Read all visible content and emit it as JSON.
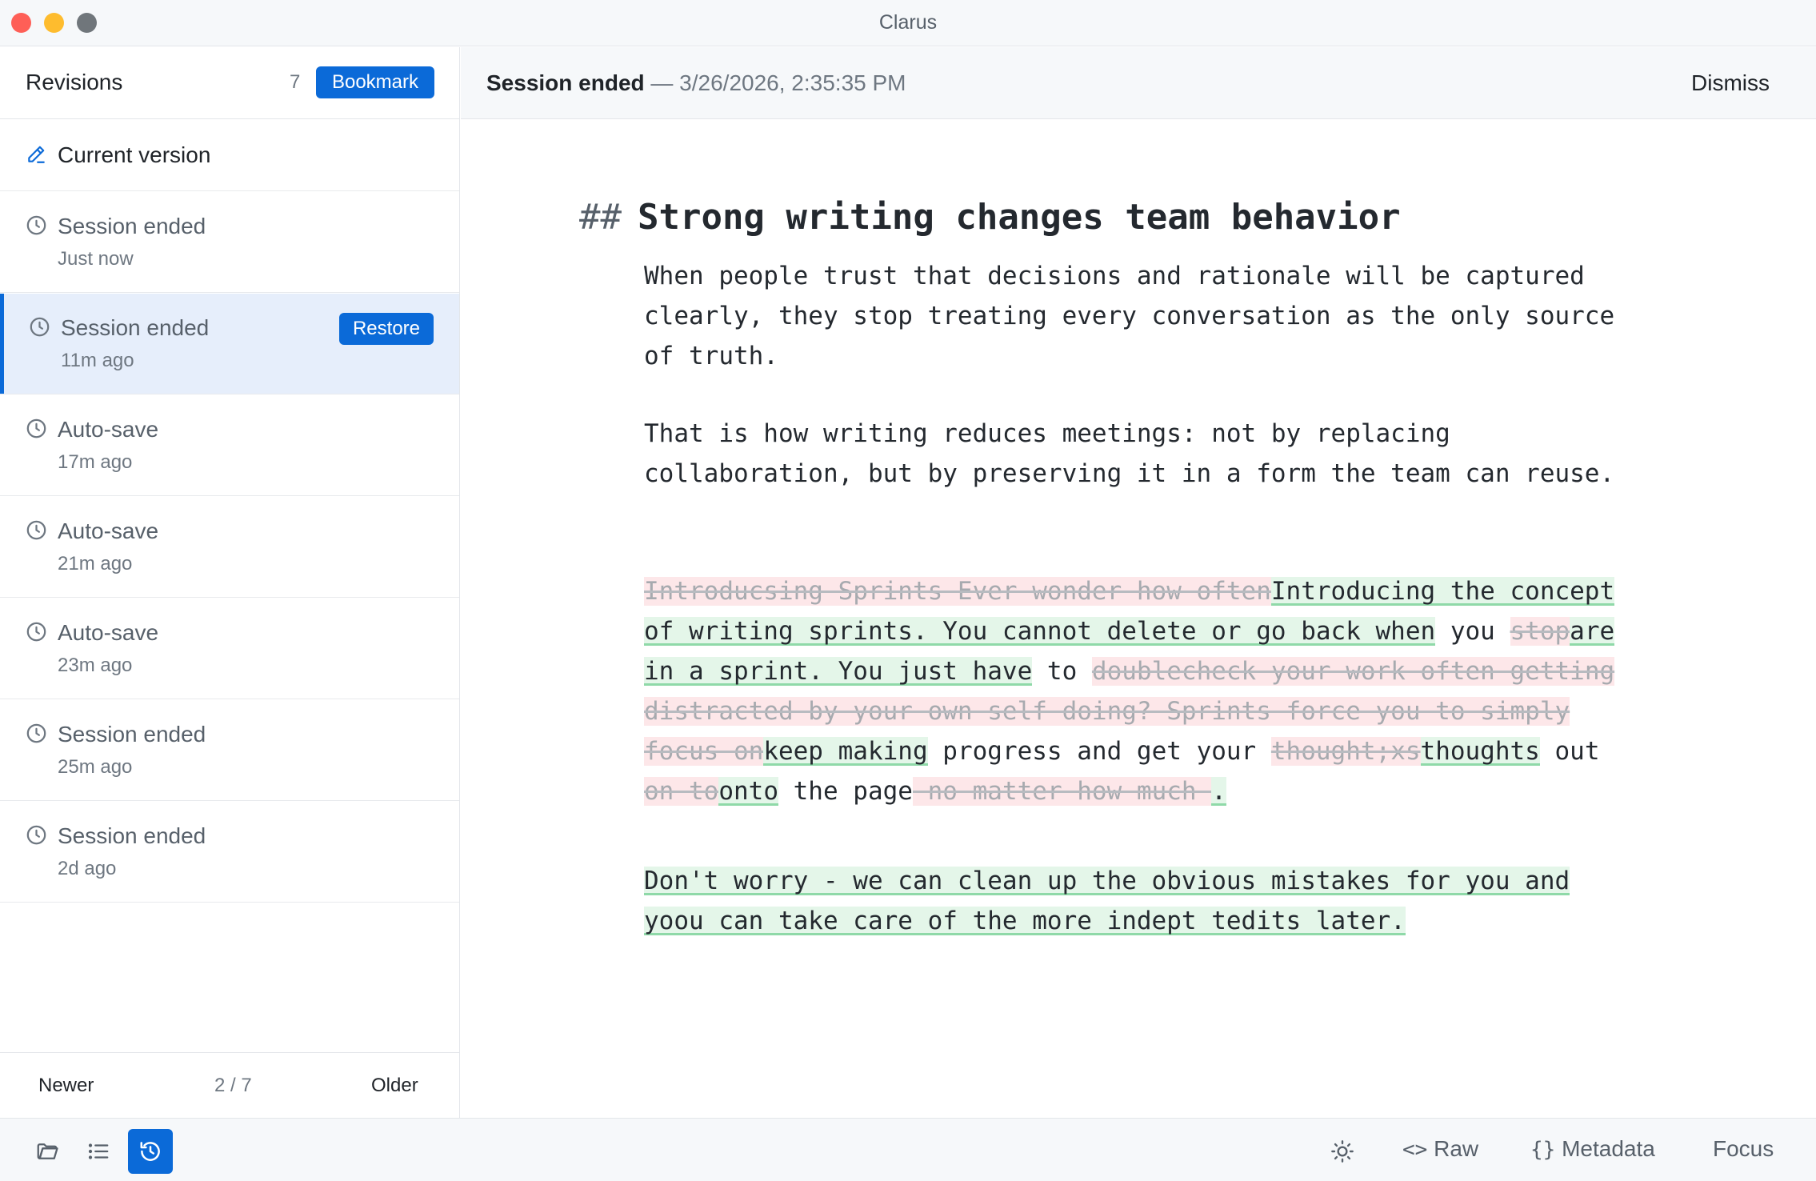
{
  "window": {
    "title": "Clarus"
  },
  "sidebar": {
    "title": "Revisions",
    "count": "7",
    "bookmark_label": "Bookmark",
    "current_version_label": "Current version",
    "revisions": [
      {
        "name": "Session ended",
        "time": "Just now"
      },
      {
        "name": "Session ended",
        "time": "11m ago",
        "selected": true,
        "action": "Restore"
      },
      {
        "name": "Auto-save",
        "time": "17m ago"
      },
      {
        "name": "Auto-save",
        "time": "21m ago"
      },
      {
        "name": "Auto-save",
        "time": "23m ago"
      },
      {
        "name": "Session ended",
        "time": "25m ago"
      },
      {
        "name": "Session ended",
        "time": "2d ago"
      }
    ],
    "pager": {
      "newer": "Newer",
      "position": "2 / 7",
      "older": "Older"
    }
  },
  "banner": {
    "title": "Session ended",
    "detail": " — 3/26/2026, 2:35:35 PM",
    "dismiss": "Dismiss"
  },
  "document": {
    "heading_marker": "##",
    "heading": "Strong writing changes team behavior",
    "p1": "When people trust that decisions and rationale will be captured clearly, they stop treating every conversation as the only source of truth.",
    "p2": "That is how writing reduces meetings: not by replacing collaboration, but by preserving it in a form the team can reuse.",
    "diff_segments": [
      {
        "type": "del",
        "text": "Introducsing Sprints Ever wonder how often"
      },
      {
        "type": "ins",
        "text": "Introducing the concept of writing sprints. You cannot delete or go back when"
      },
      {
        "type": "same",
        "text": " you "
      },
      {
        "type": "del",
        "text": "stop"
      },
      {
        "type": "ins",
        "text": "are in a sprint. You just have"
      },
      {
        "type": "same",
        "text": " to "
      },
      {
        "type": "del",
        "text": "doublecheck your work often getting distracted by your own self doing? Sprints force you to simply focus on"
      },
      {
        "type": "ins",
        "text": "keep making"
      },
      {
        "type": "same",
        "text": " progress and get your "
      },
      {
        "type": "del",
        "text": "thought;xs"
      },
      {
        "type": "ins",
        "text": "thoughts"
      },
      {
        "type": "same",
        "text": " out "
      },
      {
        "type": "del",
        "text": "on to"
      },
      {
        "type": "ins",
        "text": "onto"
      },
      {
        "type": "same",
        "text": " the page"
      },
      {
        "type": "del",
        "text": " no matter how much "
      },
      {
        "type": "ins",
        "text": "."
      }
    ],
    "p4": "Don't worry - we can clean up the obvious mistakes for you and yoou can take care of the more indept tedits later."
  },
  "bottombar": {
    "icons": [
      "folder-icon",
      "list-icon",
      "history-icon"
    ],
    "theme_icon": "sun-icon",
    "raw_glyph": "<>",
    "raw_label": "Raw",
    "metadata_glyph": "{}",
    "metadata_label": "Metadata",
    "focus_label": "Focus"
  },
  "colors": {
    "accent": "#0b6ad8",
    "deleted_bg": "#fde7e9",
    "inserted_bg": "#e4f6e9"
  }
}
